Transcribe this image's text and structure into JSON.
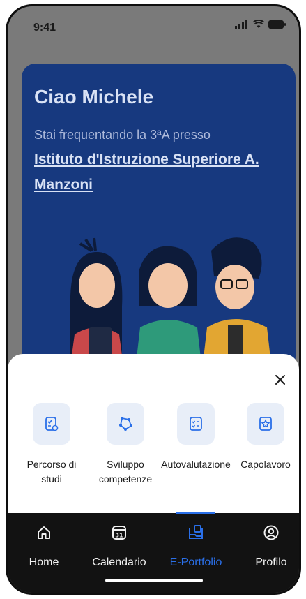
{
  "status_bar": {
    "time": "9:41"
  },
  "hero": {
    "greeting": "Ciao Michele",
    "subtitle": "Stai frequentando la 3ªA presso",
    "school": "Istituto d'Istruzione Superiore A. Manzoni"
  },
  "sheet": {
    "actions": [
      {
        "label": "Percorso di studi",
        "icon": "route-icon"
      },
      {
        "label": "Sviluppo competenze",
        "icon": "skills-icon"
      },
      {
        "label": "Autovalutazione",
        "icon": "checklist-icon"
      },
      {
        "label": "Capolavoro",
        "icon": "star-icon"
      }
    ]
  },
  "tabbar": {
    "tabs": [
      {
        "label": "Home",
        "icon": "home-icon",
        "active": false
      },
      {
        "label": "Calendario",
        "icon": "calendar-icon",
        "badge": "31",
        "active": false
      },
      {
        "label": "E-Portfolio",
        "icon": "portfolio-icon",
        "active": true
      },
      {
        "label": "Profilo",
        "icon": "profile-icon",
        "active": false
      }
    ]
  },
  "colors": {
    "accent": "#2a6fe8",
    "hero_bg": "#17397f",
    "tile_bg": "#e8eef8",
    "tabbar_bg": "#121212"
  }
}
